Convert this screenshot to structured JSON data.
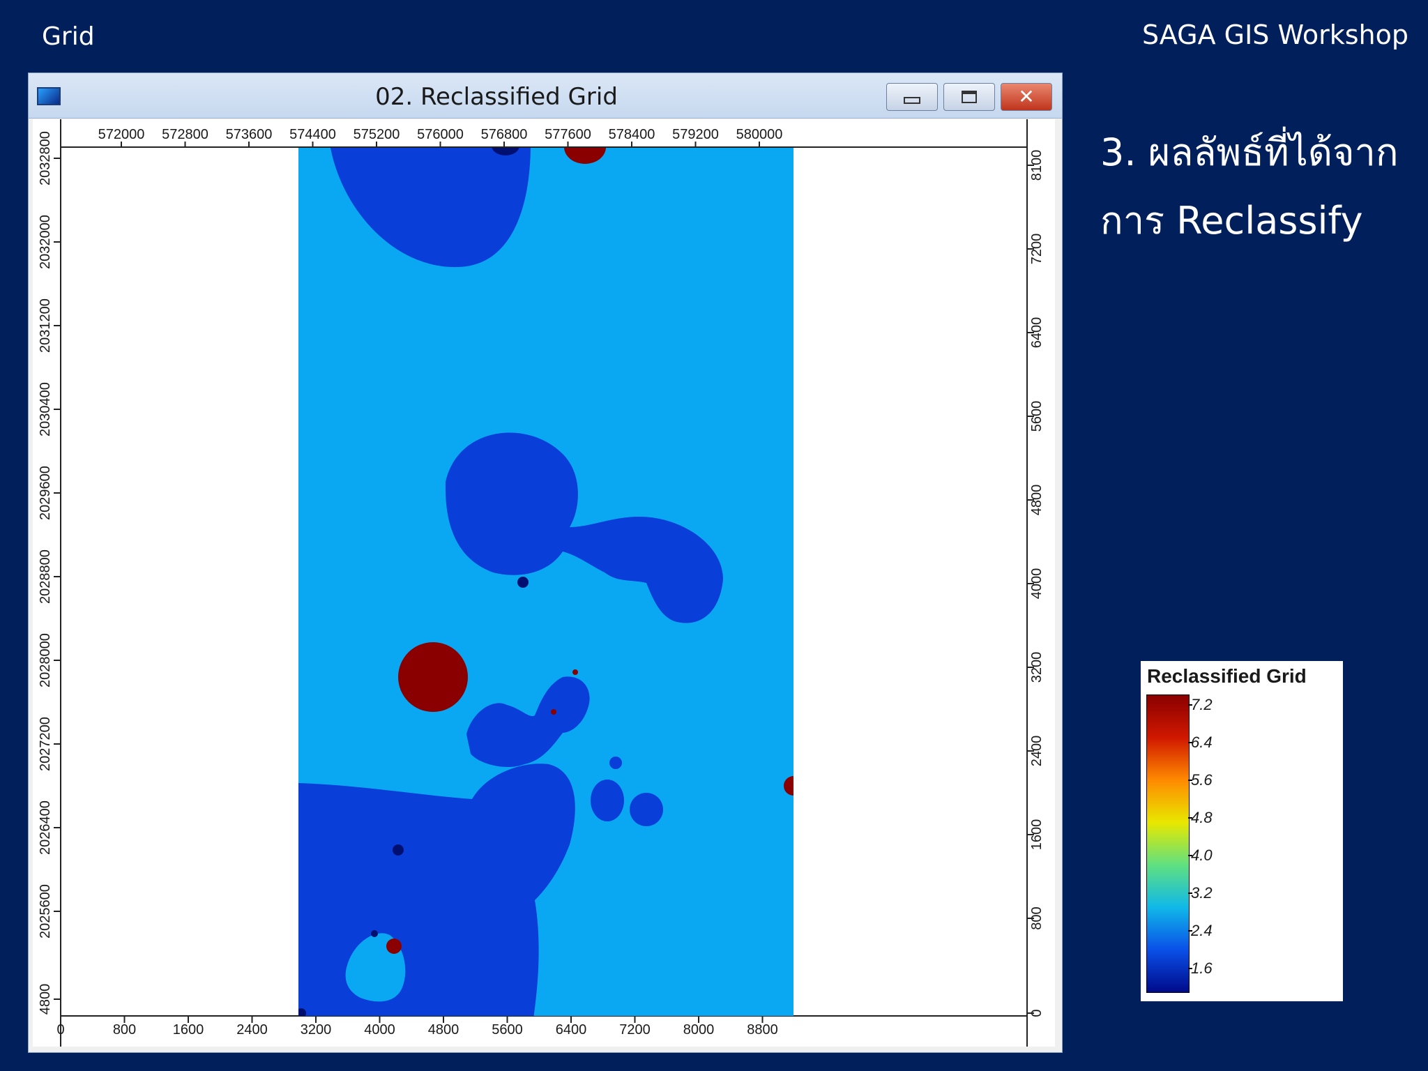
{
  "slide": {
    "title": "Grid",
    "brand": "SAGA GIS Workshop",
    "text_line1": "3. ผลลัพธ์ที่ได้จาก",
    "text_line2": "การ Reclassify"
  },
  "window": {
    "title": "02. Reclassified Grid",
    "buttons": {
      "minimize": "minimize",
      "maximize": "maximize",
      "close": "close"
    }
  },
  "map": {
    "top_ticks": [
      "572000",
      "572800",
      "573600",
      "574400",
      "575200",
      "576000",
      "576800",
      "577600",
      "578400",
      "579200",
      "580000"
    ],
    "left_ticks": [
      "2032800",
      "2032000",
      "2031200",
      "2030400",
      "2029600",
      "2028800",
      "2028000",
      "2027200",
      "2026400",
      "2025600",
      "4800"
    ],
    "bottom_ticks": [
      "0",
      "800",
      "1600",
      "2400",
      "3200",
      "4000",
      "4800",
      "5600",
      "6400",
      "7200",
      "8000",
      "8800"
    ],
    "right_ticks": [
      "8100",
      "7200",
      "6400",
      "5600",
      "4800",
      "4000",
      "3200",
      "2400",
      "1600",
      "800",
      "0"
    ],
    "colors": {
      "background": "#0aa8f2",
      "low": "#0a3ed8",
      "lowest": "#001070",
      "high": "#8a0000"
    }
  },
  "legend": {
    "title": "Reclassified Grid",
    "ticks": [
      "7.2",
      "6.4",
      "5.6",
      "4.8",
      "4.0",
      "3.2",
      "2.4",
      "1.6"
    ],
    "gradient": [
      "#8a0000",
      "#d01800",
      "#ff8a00",
      "#e8e800",
      "#60e080",
      "#10b8e8",
      "#0a50e8",
      "#000a8a"
    ]
  }
}
